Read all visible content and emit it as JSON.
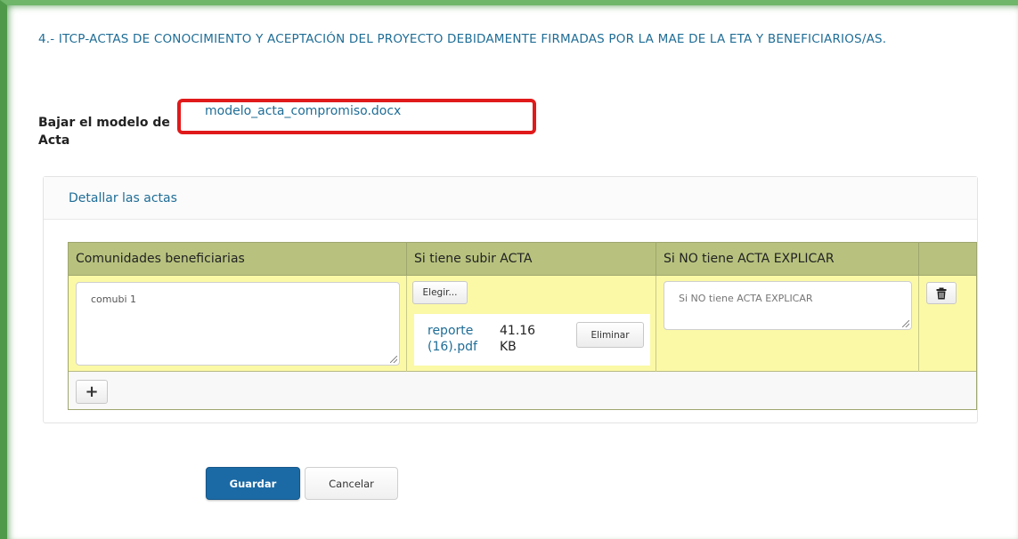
{
  "section": {
    "title": "4.- ITCP-ACTAS DE CONOCIMIENTO Y ACEPTACIÓN DEL PROYECTO DEBIDAMENTE FIRMADAS POR LA MAE DE LA ETA Y BENEFICIARIOS/AS."
  },
  "download": {
    "label": "Bajar el modelo de Acta",
    "file_name": "modelo_acta_compromiso.docx"
  },
  "panel": {
    "heading": "Detallar las actas"
  },
  "table": {
    "columns": [
      "Comunidades beneficiarias",
      "Si tiene subir ACTA",
      "Si NO tiene ACTA EXPLICAR"
    ],
    "rows": [
      {
        "community": "comubi 1",
        "choose_label": "Elegir...",
        "file_name": "reporte (16).pdf",
        "file_size": "41.16 KB",
        "remove_label": "Eliminar",
        "explain_value": "",
        "explain_placeholder": "Si NO tiene ACTA EXPLICAR",
        "delete_icon": "trash-icon"
      }
    ],
    "add_icon": "plus-icon",
    "add_symbol": "+"
  },
  "actions": {
    "save_label": "Guardar",
    "cancel_label": "Cancelar"
  },
  "colors": {
    "accent": "#1b6aa5",
    "link": "#1f6d96",
    "header_bg": "#b8c27e",
    "row_bg": "#fbf9a6",
    "highlight": "#e01a1a",
    "frame_green": "#4f9a4a"
  }
}
